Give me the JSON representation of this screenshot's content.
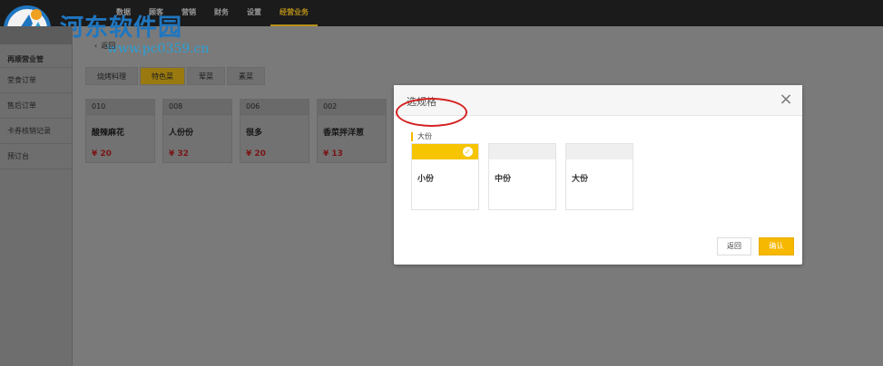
{
  "topnav": [
    "数据",
    "顾客",
    "营销",
    "财务",
    "设置",
    "经营业务"
  ],
  "watermark": {
    "name": "河东软件园",
    "url": "www.pc0359.cn"
  },
  "sidebar": [
    "再顺营业管",
    "堂食订单",
    "售后订单",
    "卡券核销记录",
    "预订台"
  ],
  "back_label": "返回",
  "tabs": [
    "烧烤料理",
    "特色菜",
    "荤菜",
    "素菜"
  ],
  "cards": [
    {
      "code": "010",
      "name": "酸辣麻花",
      "price": "¥ 20"
    },
    {
      "code": "008",
      "name": "人份份",
      "price": "¥ 32"
    },
    {
      "code": "006",
      "name": "很多",
      "price": "¥ 20"
    },
    {
      "code": "002",
      "name": "香菜拌洋葱",
      "price": "¥ 13"
    }
  ],
  "modal": {
    "title": "选规格",
    "close": "×",
    "group_label": "大份",
    "options": [
      {
        "label": "小份",
        "selected": true
      },
      {
        "label": "中份",
        "selected": false
      },
      {
        "label": "大份",
        "selected": false
      }
    ],
    "check_glyph": "✓",
    "back_button": "返回",
    "confirm_button": "确认"
  },
  "colors": {
    "accent": "#f6b800",
    "annotation": "#d42222",
    "watermark": "#1f76c0"
  }
}
